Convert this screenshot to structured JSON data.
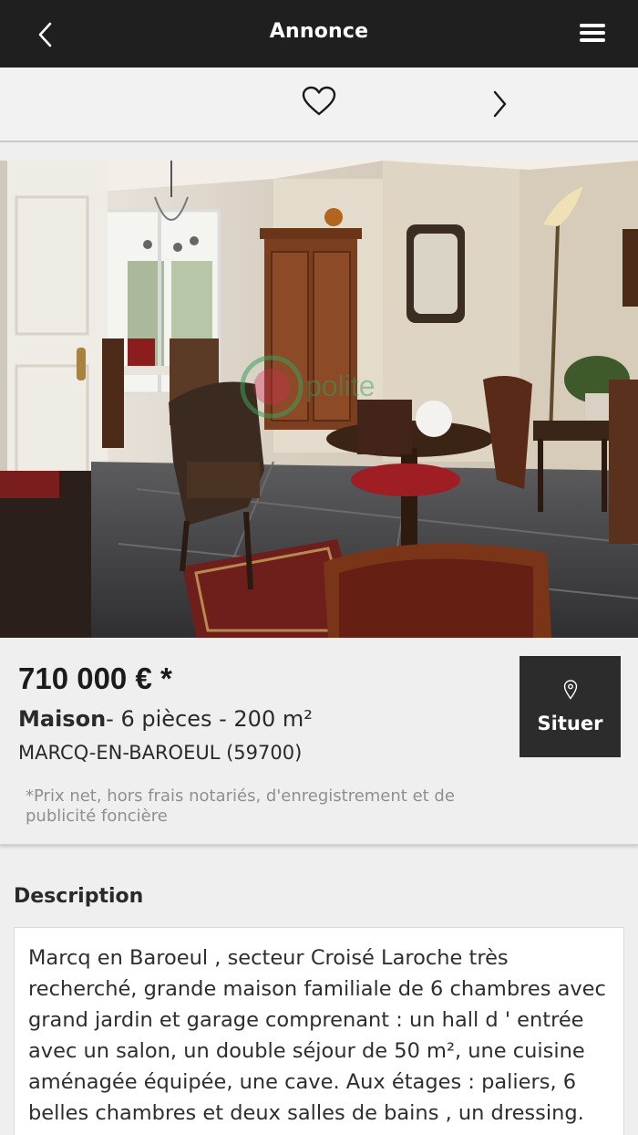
{
  "header": {
    "title": "Annonce",
    "back_icon": "chevron-left-icon",
    "menu_icon": "hamburger-menu-icon"
  },
  "actions": {
    "favorite_icon": "heart-outline-icon",
    "next_icon": "chevron-right-icon"
  },
  "listing": {
    "price": "710 000 € *",
    "type": "Maison",
    "details": "- 6 pièces - 200 m²",
    "city": "MARCQ-EN-BAROEUL (59700)",
    "price_note": "*Prix net, hors frais notariés, d'enregistrement et de publicité foncière",
    "locate_label": "Situer",
    "locate_icon": "map-pin-icon"
  },
  "description": {
    "heading": "Description",
    "text": "Marcq en Baroeul , secteur Croisé Laroche très recherché, grande maison familiale de 6 chambres avec grand jardin et garage comprenant : un hall d ' entrée avec un salon, un double séjour de 50 m², une cuisine aménagée équipée, une cave. Aux étages : paliers, 6 belles chambres et deux salles de bains , un dressing."
  },
  "colors": {
    "topbar": "#1f1f1f",
    "page_bg": "#efefef",
    "locate_bg": "#2c2c2c"
  }
}
